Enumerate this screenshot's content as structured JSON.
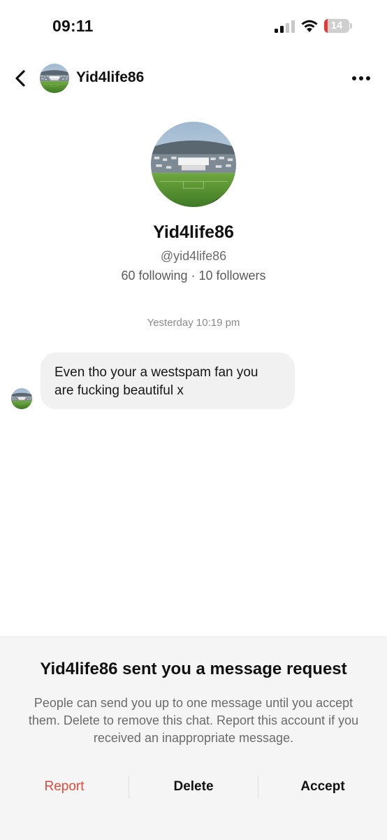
{
  "status_bar": {
    "time": "09:11",
    "battery_level": "14",
    "battery_color": "#e53935",
    "signal_bars_active": 2,
    "signal_bars_total": 4,
    "icons": [
      "signal-icon",
      "wifi-icon",
      "battery-icon"
    ]
  },
  "header": {
    "title": "Yid4life86",
    "back_icon": "chevron-left-icon",
    "more_icon": "more-horizontal-icon"
  },
  "profile": {
    "display_name": "Yid4life86",
    "handle": "@yid4life86",
    "following_count": "60 following",
    "separator": "·",
    "followers_count": "10 followers",
    "avatar_description": "stadium-avatar-image"
  },
  "conversation": {
    "timestamp": "Yesterday 10:19 pm",
    "messages": [
      {
        "text": "Even tho your a westspam fan you are fucking beautiful x"
      }
    ]
  },
  "request_sheet": {
    "title": "Yid4life86 sent you a message request",
    "description": "People can send you up to one message until you accept them. Delete to remove this chat. Report this account if you received an inappropriate message.",
    "report_label": "Report",
    "delete_label": "Delete",
    "accept_label": "Accept",
    "report_color": "#e5493c"
  }
}
